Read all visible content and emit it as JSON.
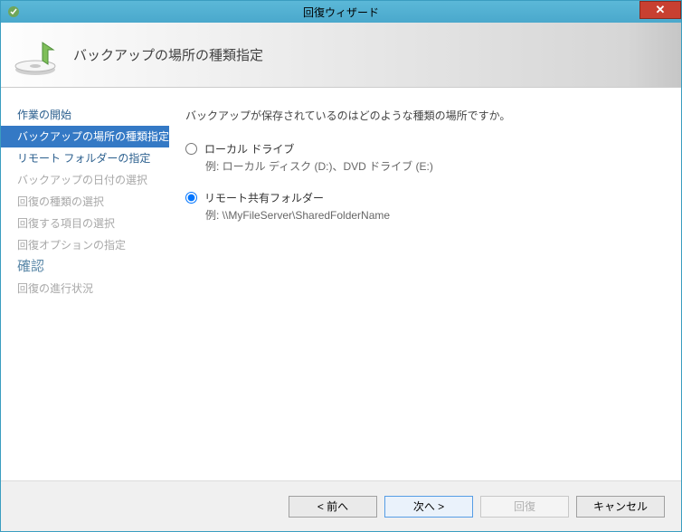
{
  "titlebar": {
    "text": "回復ウィザード"
  },
  "header": {
    "title": "バックアップの場所の種類指定"
  },
  "sidebar": {
    "items": [
      {
        "label": "作業の開始"
      },
      {
        "label": "バックアップの場所の種類指定"
      },
      {
        "label": "リモート フォルダーの指定"
      },
      {
        "label": "バックアップの日付の選択"
      },
      {
        "label": "回復の種類の選択"
      },
      {
        "label": "回復する項目の選択"
      },
      {
        "label": "回復オプションの指定"
      },
      {
        "label": "確認"
      },
      {
        "label": "回復の進行状況"
      }
    ]
  },
  "main": {
    "prompt": "バックアップが保存されているのはどのような種類の場所ですか。",
    "radio1": {
      "label": "ローカル ドライブ",
      "example": "例: ローカル ディスク (D:)、DVD ドライブ (E:)"
    },
    "radio2": {
      "label": "リモート共有フォルダー",
      "example": "例: \\\\MyFileServer\\SharedFolderName"
    }
  },
  "footer": {
    "back": "< 前へ",
    "next": "次へ >",
    "recover": "回復",
    "cancel": "キャンセル"
  }
}
